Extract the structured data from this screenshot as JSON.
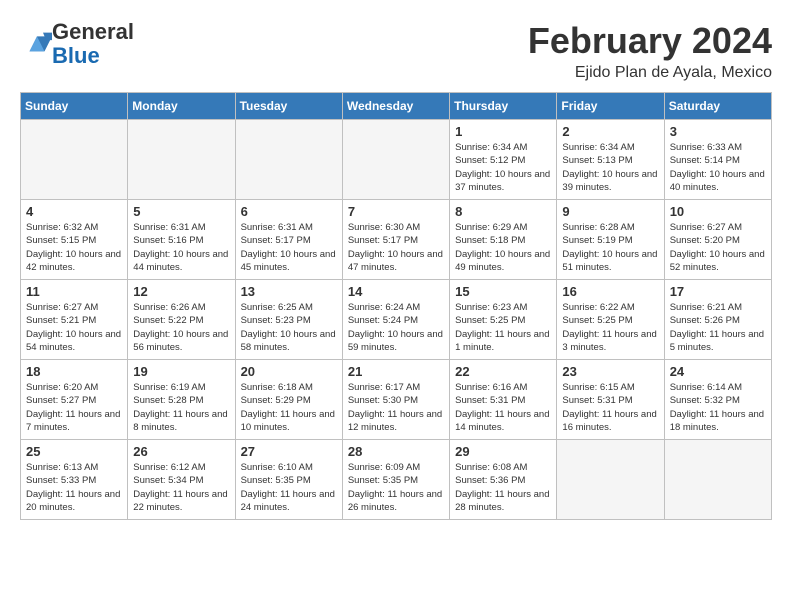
{
  "header": {
    "logo_line1": "General",
    "logo_line2": "Blue",
    "month": "February 2024",
    "location": "Ejido Plan de Ayala, Mexico"
  },
  "days_of_week": [
    "Sunday",
    "Monday",
    "Tuesday",
    "Wednesday",
    "Thursday",
    "Friday",
    "Saturday"
  ],
  "weeks": [
    [
      {
        "day": "",
        "info": ""
      },
      {
        "day": "",
        "info": ""
      },
      {
        "day": "",
        "info": ""
      },
      {
        "day": "",
        "info": ""
      },
      {
        "day": "1",
        "info": "Sunrise: 6:34 AM\nSunset: 5:12 PM\nDaylight: 10 hours and 37 minutes."
      },
      {
        "day": "2",
        "info": "Sunrise: 6:34 AM\nSunset: 5:13 PM\nDaylight: 10 hours and 39 minutes."
      },
      {
        "day": "3",
        "info": "Sunrise: 6:33 AM\nSunset: 5:14 PM\nDaylight: 10 hours and 40 minutes."
      }
    ],
    [
      {
        "day": "4",
        "info": "Sunrise: 6:32 AM\nSunset: 5:15 PM\nDaylight: 10 hours and 42 minutes."
      },
      {
        "day": "5",
        "info": "Sunrise: 6:31 AM\nSunset: 5:16 PM\nDaylight: 10 hours and 44 minutes."
      },
      {
        "day": "6",
        "info": "Sunrise: 6:31 AM\nSunset: 5:17 PM\nDaylight: 10 hours and 45 minutes."
      },
      {
        "day": "7",
        "info": "Sunrise: 6:30 AM\nSunset: 5:17 PM\nDaylight: 10 hours and 47 minutes."
      },
      {
        "day": "8",
        "info": "Sunrise: 6:29 AM\nSunset: 5:18 PM\nDaylight: 10 hours and 49 minutes."
      },
      {
        "day": "9",
        "info": "Sunrise: 6:28 AM\nSunset: 5:19 PM\nDaylight: 10 hours and 51 minutes."
      },
      {
        "day": "10",
        "info": "Sunrise: 6:27 AM\nSunset: 5:20 PM\nDaylight: 10 hours and 52 minutes."
      }
    ],
    [
      {
        "day": "11",
        "info": "Sunrise: 6:27 AM\nSunset: 5:21 PM\nDaylight: 10 hours and 54 minutes."
      },
      {
        "day": "12",
        "info": "Sunrise: 6:26 AM\nSunset: 5:22 PM\nDaylight: 10 hours and 56 minutes."
      },
      {
        "day": "13",
        "info": "Sunrise: 6:25 AM\nSunset: 5:23 PM\nDaylight: 10 hours and 58 minutes."
      },
      {
        "day": "14",
        "info": "Sunrise: 6:24 AM\nSunset: 5:24 PM\nDaylight: 10 hours and 59 minutes."
      },
      {
        "day": "15",
        "info": "Sunrise: 6:23 AM\nSunset: 5:25 PM\nDaylight: 11 hours and 1 minute."
      },
      {
        "day": "16",
        "info": "Sunrise: 6:22 AM\nSunset: 5:25 PM\nDaylight: 11 hours and 3 minutes."
      },
      {
        "day": "17",
        "info": "Sunrise: 6:21 AM\nSunset: 5:26 PM\nDaylight: 11 hours and 5 minutes."
      }
    ],
    [
      {
        "day": "18",
        "info": "Sunrise: 6:20 AM\nSunset: 5:27 PM\nDaylight: 11 hours and 7 minutes."
      },
      {
        "day": "19",
        "info": "Sunrise: 6:19 AM\nSunset: 5:28 PM\nDaylight: 11 hours and 8 minutes."
      },
      {
        "day": "20",
        "info": "Sunrise: 6:18 AM\nSunset: 5:29 PM\nDaylight: 11 hours and 10 minutes."
      },
      {
        "day": "21",
        "info": "Sunrise: 6:17 AM\nSunset: 5:30 PM\nDaylight: 11 hours and 12 minutes."
      },
      {
        "day": "22",
        "info": "Sunrise: 6:16 AM\nSunset: 5:31 PM\nDaylight: 11 hours and 14 minutes."
      },
      {
        "day": "23",
        "info": "Sunrise: 6:15 AM\nSunset: 5:31 PM\nDaylight: 11 hours and 16 minutes."
      },
      {
        "day": "24",
        "info": "Sunrise: 6:14 AM\nSunset: 5:32 PM\nDaylight: 11 hours and 18 minutes."
      }
    ],
    [
      {
        "day": "25",
        "info": "Sunrise: 6:13 AM\nSunset: 5:33 PM\nDaylight: 11 hours and 20 minutes."
      },
      {
        "day": "26",
        "info": "Sunrise: 6:12 AM\nSunset: 5:34 PM\nDaylight: 11 hours and 22 minutes."
      },
      {
        "day": "27",
        "info": "Sunrise: 6:10 AM\nSunset: 5:35 PM\nDaylight: 11 hours and 24 minutes."
      },
      {
        "day": "28",
        "info": "Sunrise: 6:09 AM\nSunset: 5:35 PM\nDaylight: 11 hours and 26 minutes."
      },
      {
        "day": "29",
        "info": "Sunrise: 6:08 AM\nSunset: 5:36 PM\nDaylight: 11 hours and 28 minutes."
      },
      {
        "day": "",
        "info": ""
      },
      {
        "day": "",
        "info": ""
      }
    ]
  ]
}
